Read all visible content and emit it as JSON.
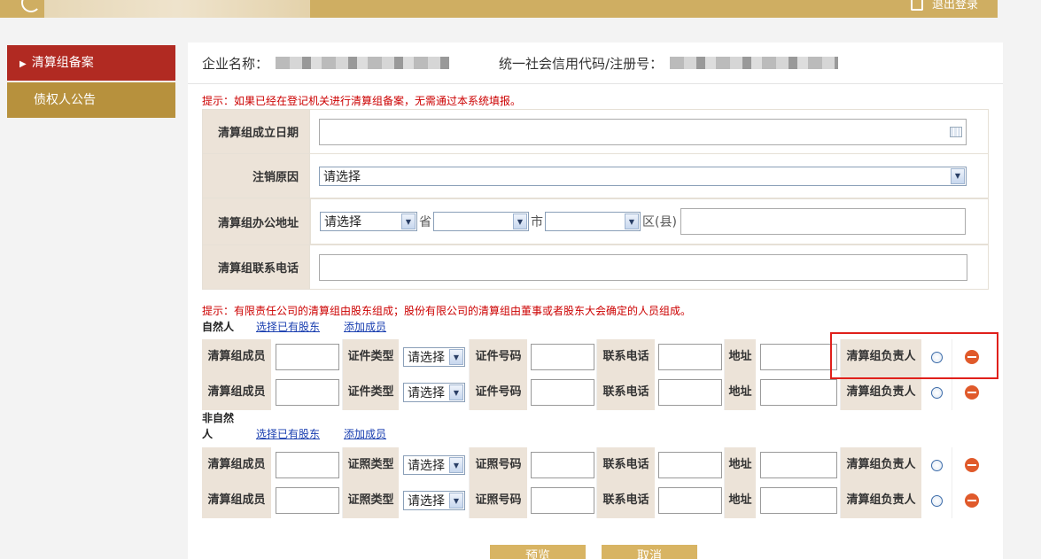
{
  "header": {
    "logout_label": "退出登录"
  },
  "sidebar": {
    "items": [
      {
        "label": "清算组备案"
      },
      {
        "label": "债权人公告"
      }
    ]
  },
  "company": {
    "name_label": "企业名称：",
    "code_label": "统一社会信用代码/注册号："
  },
  "hint1": "提示：如果已经在登记机关进行清算组备案，无需通过本系统填报。",
  "form": {
    "date_label": "清算组成立日期",
    "reason_label": "注销原因",
    "reason_value": "请选择",
    "address_label": "清算组办公地址",
    "province_value": "请选择",
    "province_unit": "省",
    "city_unit": "市",
    "district_unit": "区(县)",
    "phone_label": "清算组联系电话"
  },
  "hint2": "提示：有限责任公司的清算组由股东组成；股份有限公司的清算组由董事或者股东大会确定的人员组成。",
  "natural": {
    "title": "自然人",
    "select_link": "选择已有股东",
    "add_link": "添加成员",
    "member_label": "清算组成员",
    "id_type_label": "证件类型",
    "id_type_value": "请选择",
    "id_no_label": "证件号码",
    "phone_label": "联系电话",
    "address_label": "地址",
    "leader_label": "清算组负责人"
  },
  "legal": {
    "title": "非自然人",
    "select_link": "选择已有股东",
    "add_link": "添加成员",
    "member_label": "清算组成员",
    "id_type_label": "证照类型",
    "id_type_value": "请选择",
    "id_no_label": "证照号码",
    "phone_label": "联系电话",
    "address_label": "地址",
    "leader_label": "清算组负责人"
  },
  "buttons": {
    "preview": "预览",
    "cancel": "取消"
  }
}
